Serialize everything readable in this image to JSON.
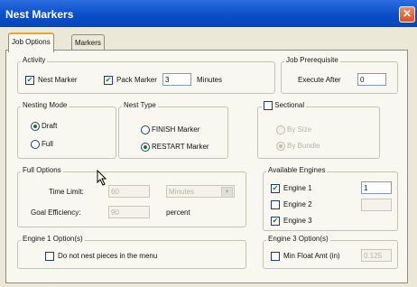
{
  "window": {
    "title": "Nest Markers",
    "close_glyph": "✕"
  },
  "tabs": [
    {
      "label": "Job Options"
    },
    {
      "label": "Markers"
    }
  ],
  "activity": {
    "title": "Activity",
    "nest_marker": {
      "label": "Nest Marker",
      "checked": true
    },
    "pack_marker": {
      "label": "Pack Marker",
      "checked": true
    },
    "minutes_value": "3",
    "minutes_label": "Minutes"
  },
  "job_prerequisite": {
    "title": "Job Prerequisite",
    "label": "Execute After",
    "value": "0"
  },
  "nesting_mode": {
    "title": "Nesting Mode",
    "draft": "Draft",
    "full": "Full",
    "selected": "draft"
  },
  "nest_type": {
    "title": "Nest Type",
    "finish": "FINISH Marker",
    "restart": "RESTART Marker",
    "selected": "restart"
  },
  "sectional": {
    "label": "Sectional",
    "checked": false,
    "by_size": "By Size",
    "by_bundle": "By Bundle"
  },
  "full_options": {
    "title": "Full Options",
    "time_limit_label": "Time Limit:",
    "time_limit_value": "60",
    "time_unit": "Minutes",
    "goal_label": "Goal Efficiency:",
    "goal_value": "90",
    "goal_unit": "percent"
  },
  "available_engines": {
    "title": "Available Engines",
    "engines": [
      {
        "label": "Engine 1",
        "checked": true,
        "value": "1"
      },
      {
        "label": "Engine 2",
        "checked": false,
        "value": ""
      },
      {
        "label": "Engine 3",
        "checked": true
      }
    ]
  },
  "engine1_options": {
    "title": "Engine 1 Option(s)",
    "label": "Do not nest pieces in the menu",
    "checked": false
  },
  "engine3_options": {
    "title": "Engine 3 Option(s)",
    "label": "Min Float Amt (in)",
    "checked": false,
    "value": "0.125"
  },
  "check_glyph": "✔",
  "dropdown_glyph": "▼"
}
